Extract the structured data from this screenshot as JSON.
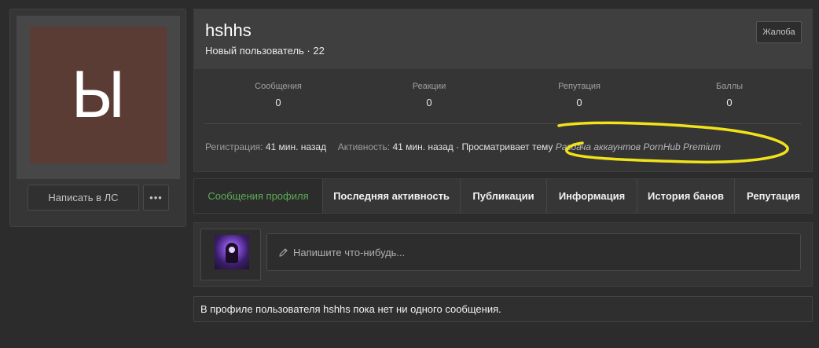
{
  "sidebar": {
    "avatar_letter": "Ы",
    "message_button": "Написать в ЛС",
    "more_button": "•••"
  },
  "profile": {
    "username": "hshhs",
    "title": "Новый пользователь · 22",
    "report_button": "Жалоба",
    "stats": [
      {
        "label": "Сообщения",
        "value": "0"
      },
      {
        "label": "Реакции",
        "value": "0"
      },
      {
        "label": "Репутация",
        "value": "0"
      },
      {
        "label": "Баллы",
        "value": "0"
      }
    ],
    "info": {
      "registration_label": "Регистрация:",
      "registration_value": "41 мин. назад",
      "activity_label": "Активность:",
      "activity_value": "41 мин. назад",
      "activity_detail": "· Просматривает тему",
      "thread_link": "Раздача аккаунтов PornHub Premium"
    },
    "highlight_color": "#f2e21a"
  },
  "tabs": [
    {
      "label": "Сообщения профиля",
      "active": true
    },
    {
      "label": "Последняя активность",
      "active": false
    },
    {
      "label": "Публикации",
      "active": false
    },
    {
      "label": "Информация",
      "active": false
    },
    {
      "label": "История банов",
      "active": false
    },
    {
      "label": "Репутация",
      "active": false
    }
  ],
  "composer": {
    "placeholder": "Напишите что-нибудь..."
  },
  "empty_message": "В профиле пользователя hshhs пока нет ни одного сообщения.",
  "colors": {
    "accent_green": "#5cad55",
    "background": "#2c2c2c"
  }
}
